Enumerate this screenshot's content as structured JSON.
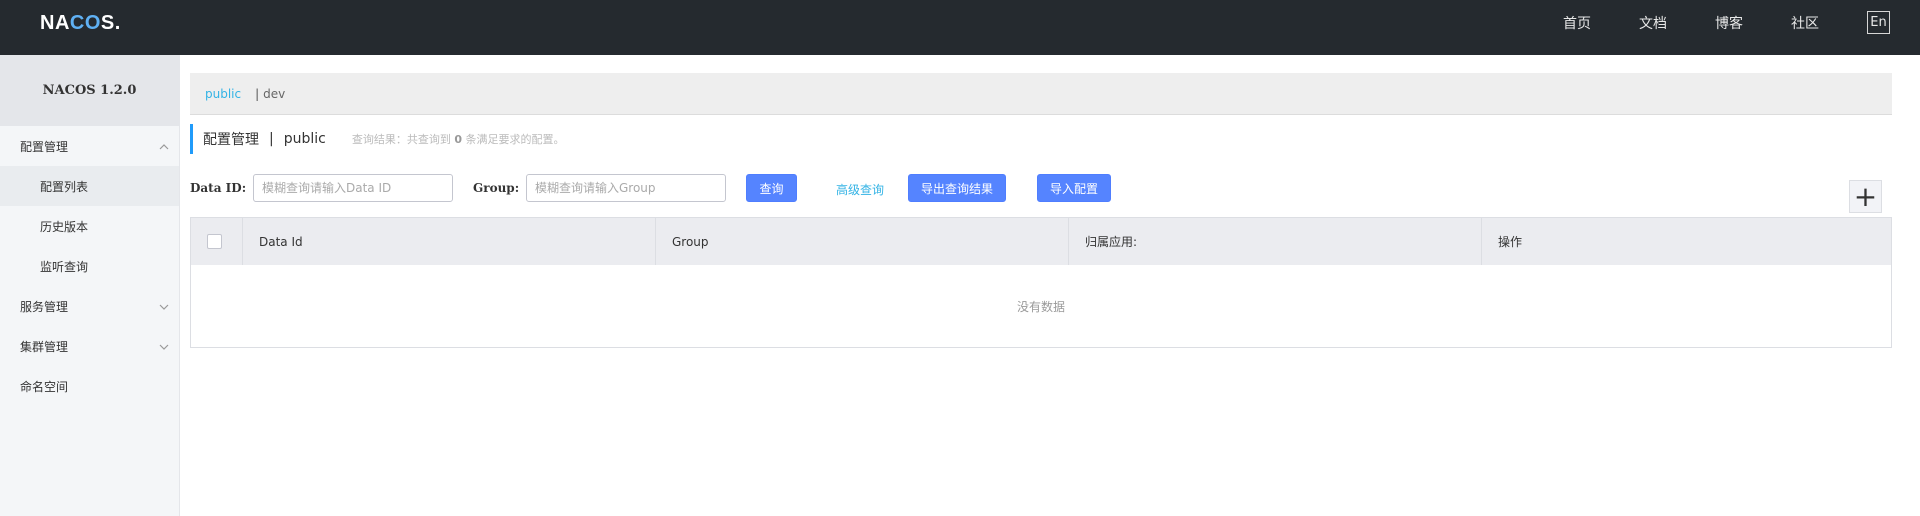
{
  "header": {
    "logo_prefix": "NA",
    "logo_co": "CO",
    "logo_suffix": "S.",
    "nav": [
      "首页",
      "文档",
      "博客",
      "社区"
    ],
    "lang": "En"
  },
  "sidebar": {
    "title": "NACOS 1.2.0",
    "config_menu": {
      "label": "配置管理",
      "icon": "chevron-up-icon"
    },
    "config_items": [
      "配置列表",
      "历史版本",
      "监听查询"
    ],
    "service_menu": {
      "label": "服务管理",
      "icon": "chevron-down-icon"
    },
    "cluster_menu": {
      "label": "集群管理",
      "icon": "chevron-down-icon"
    },
    "namespace_menu": {
      "label": "命名空间"
    }
  },
  "namespaces": {
    "active": "public",
    "separator": "|",
    "other": "dev"
  },
  "page": {
    "title": "配置管理",
    "separator": "|",
    "namespace": "public",
    "result_prefix": "查询结果：共查询到",
    "result_count": "0",
    "result_suffix": "条满足要求的配置。"
  },
  "filter": {
    "data_id_label": "Data ID:",
    "data_id_placeholder": "模糊查询请输入Data ID",
    "group_label": "Group:",
    "group_placeholder": "模糊查询请输入Group",
    "search_button": "查询",
    "advanced_link": "高级查询",
    "export_button": "导出查询结果",
    "import_button": "导入配置",
    "add_icon": "plus-icon",
    "add_symbol": "+"
  },
  "table": {
    "columns": [
      "Data Id",
      "Group",
      "归属应用:",
      "操作"
    ],
    "empty_text": "没有数据"
  },
  "colors": {
    "header_bg": "#252a2f",
    "primary": "#5584ff",
    "link": "#33b3e5",
    "accent_bar": "#209bfa"
  }
}
